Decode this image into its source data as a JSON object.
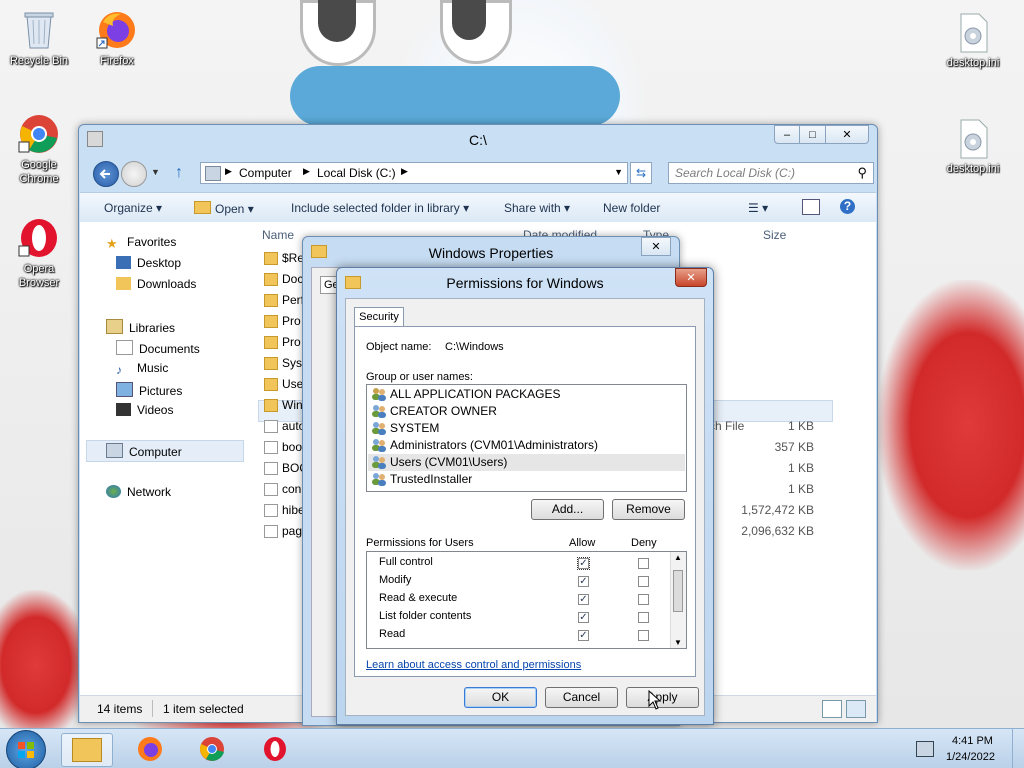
{
  "desktop": {
    "icons": {
      "recycle_bin": "Recycle Bin",
      "firefox": "Firefox",
      "chrome": "Google Chrome",
      "opera": "Opera Browser",
      "desktop_ini_1": "desktop.ini",
      "desktop_ini_2": "desktop.ini"
    }
  },
  "explorer": {
    "title": "C:\\",
    "address": [
      "Computer",
      "Local Disk (C:)"
    ],
    "search_placeholder": "Search Local Disk (C:)",
    "commands": {
      "organize": "Organize",
      "open": "Open",
      "include": "Include selected folder in library",
      "share": "Share with",
      "new_folder": "New folder"
    },
    "nav": {
      "favorites": "Favorites",
      "desktop": "Desktop",
      "downloads": "Downloads",
      "libraries": "Libraries",
      "documents": "Documents",
      "music": "Music",
      "pictures": "Pictures",
      "videos": "Videos",
      "computer": "Computer",
      "network": "Network"
    },
    "columns": {
      "name": "Name",
      "date": "Date modified",
      "type": "Type",
      "size": "Size"
    },
    "files": [
      {
        "name": "$Re",
        "type": "",
        "size": ""
      },
      {
        "name": "Doc",
        "type": "",
        "size": ""
      },
      {
        "name": "Perf",
        "type": "",
        "size": ""
      },
      {
        "name": "Pro",
        "type": "",
        "size": ""
      },
      {
        "name": "Pro",
        "type": "",
        "size": ""
      },
      {
        "name": "Syst",
        "type": "",
        "size": ""
      },
      {
        "name": "Use",
        "type": "",
        "size": ""
      },
      {
        "name": "Win",
        "type": "",
        "size": ""
      },
      {
        "name": "auto",
        "type": "ch File",
        "size": "1 KB"
      },
      {
        "name": "boo",
        "type": "",
        "size": "357 KB"
      },
      {
        "name": "BOO",
        "type": "",
        "size": "1 KB"
      },
      {
        "name": "con",
        "type": "",
        "size": "1 KB"
      },
      {
        "name": "hibe",
        "type": "",
        "size": "1,572,472 KB"
      },
      {
        "name": "pag",
        "type": "",
        "size": "2,096,632 KB"
      }
    ],
    "status": {
      "count": "14 items",
      "selected": "1 item selected"
    }
  },
  "properties": {
    "title": "Windows Properties",
    "tab_partial": "Ge"
  },
  "permissions": {
    "title": "Permissions for Windows",
    "tab": "Security",
    "object_label": "Object name:",
    "object_value": "C:\\Windows",
    "group_label": "Group or user names:",
    "users": [
      "ALL APPLICATION PACKAGES",
      "CREATOR OWNER",
      "SYSTEM",
      "Administrators (CVM01\\Administrators)",
      "Users (CVM01\\Users)",
      "TrustedInstaller"
    ],
    "add_button": "Add...",
    "remove_button": "Remove",
    "perm_label": "Permissions for Users",
    "allow_header": "Allow",
    "deny_header": "Deny",
    "perms": [
      {
        "name": "Full control",
        "allow": true,
        "deny": false
      },
      {
        "name": "Modify",
        "allow": true,
        "deny": false
      },
      {
        "name": "Read & execute",
        "allow": true,
        "deny": false
      },
      {
        "name": "List folder contents",
        "allow": true,
        "deny": false
      },
      {
        "name": "Read",
        "allow": true,
        "deny": false
      }
    ],
    "learn_link": "Learn about access control and permissions",
    "ok_button": "OK",
    "cancel_button": "Cancel",
    "apply_button": "Apply"
  },
  "taskbar": {
    "time": "4:41 PM",
    "date": "1/24/2022"
  }
}
